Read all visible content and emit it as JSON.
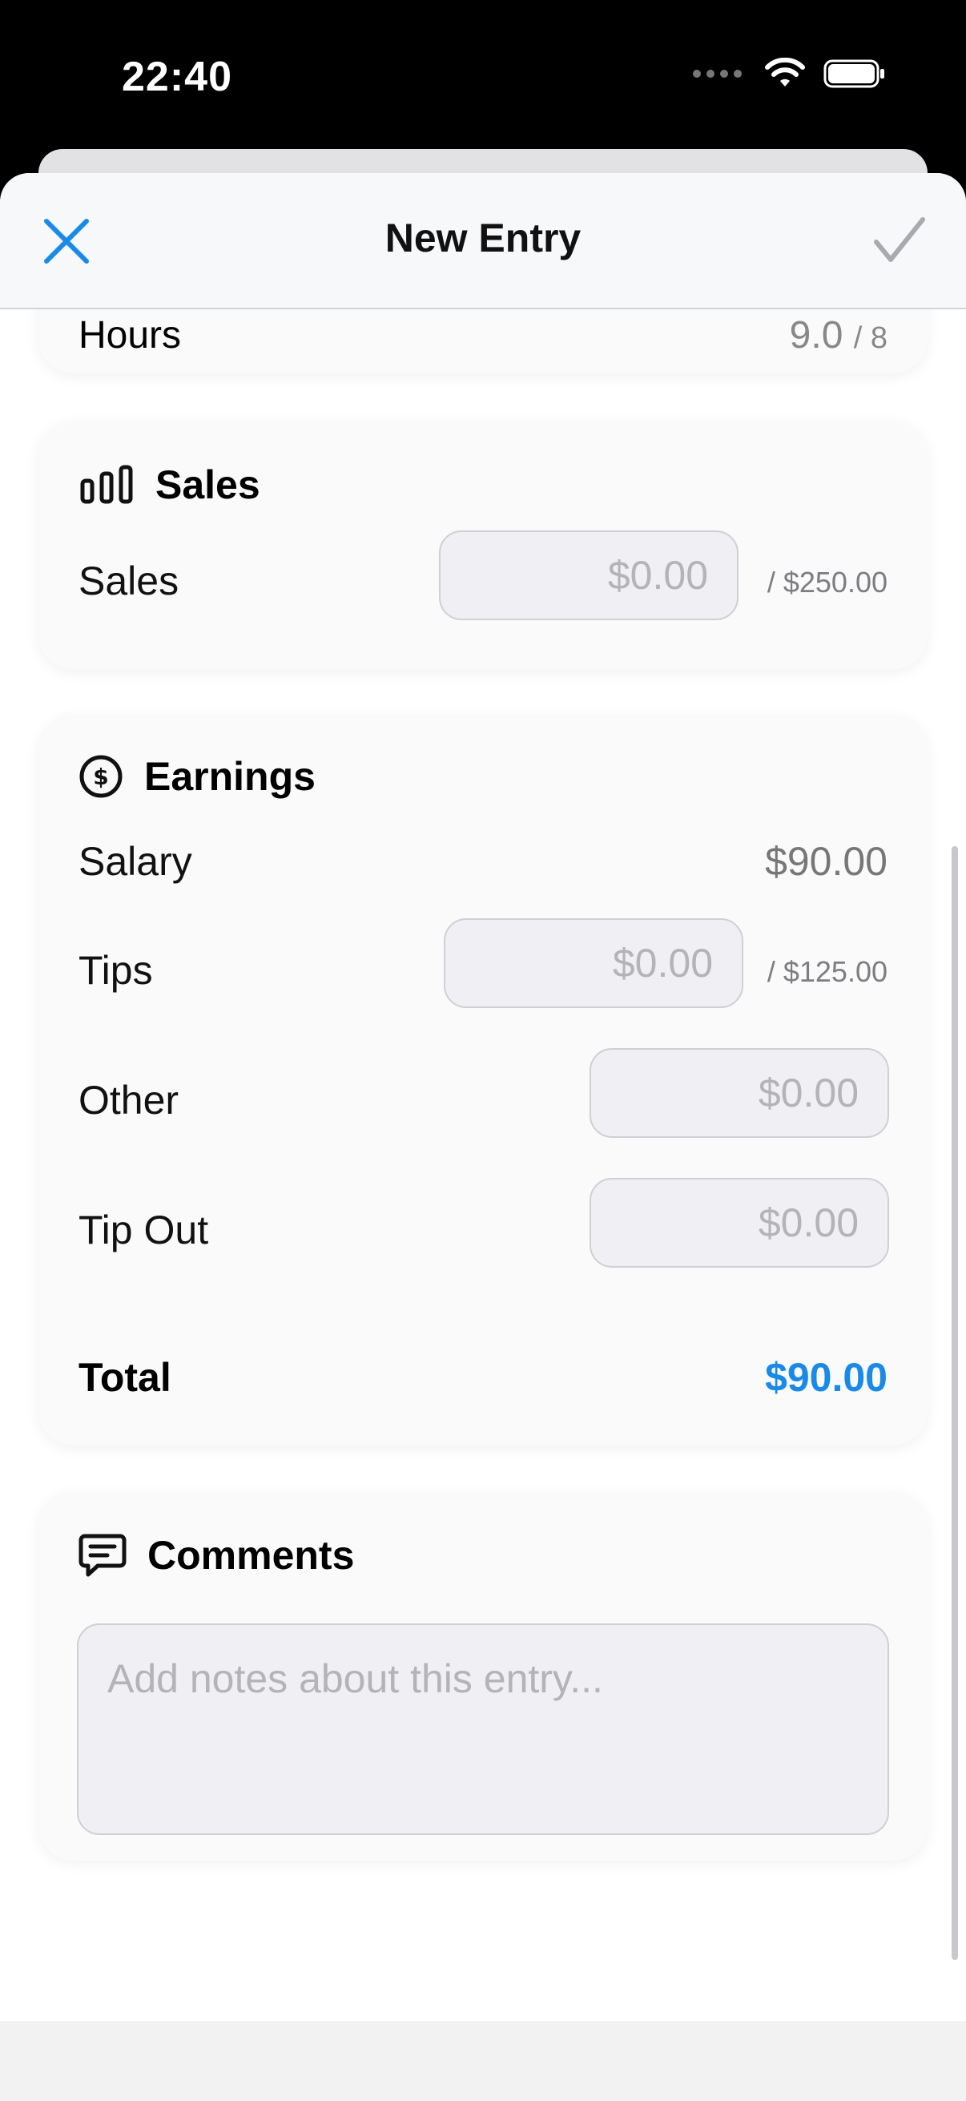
{
  "status": {
    "time": "22:40"
  },
  "nav": {
    "title": "New Entry"
  },
  "hours": {
    "label": "Hours",
    "value": "9.0",
    "suffix": "/ 8"
  },
  "sales": {
    "title": "Sales",
    "label": "Sales",
    "placeholder": "$0.00",
    "suffix": "/ $250.00"
  },
  "earnings": {
    "title": "Earnings",
    "salary_label": "Salary",
    "salary_value": "$90.00",
    "tips_label": "Tips",
    "tips_placeholder": "$0.00",
    "tips_suffix": "/ $125.00",
    "other_label": "Other",
    "other_placeholder": "$0.00",
    "tipout_label": "Tip Out",
    "tipout_placeholder": "$0.00",
    "total_label": "Total",
    "total_value": "$90.00"
  },
  "comments": {
    "title": "Comments",
    "placeholder": "Add notes about this entry..."
  },
  "colors": {
    "accent": "#1a8ae8",
    "sheet": "#ffffff",
    "card": "#fafafa"
  },
  "icons": {
    "close": "close-icon",
    "save": "checkmark-icon",
    "sales": "bar-chart-icon",
    "earnings": "dollar-circle-icon",
    "comments": "message-icon"
  }
}
